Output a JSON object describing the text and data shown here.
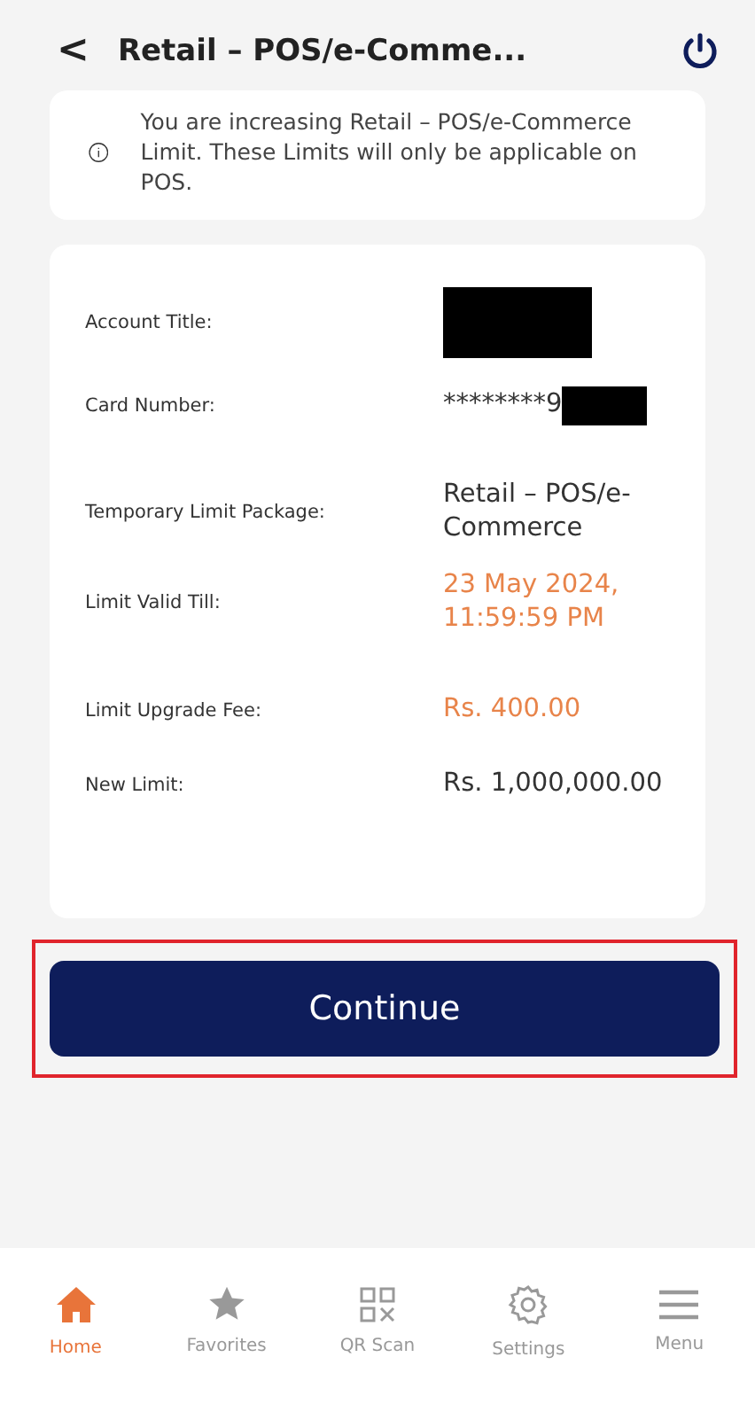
{
  "header": {
    "back": "<",
    "title": "Retail – POS/e-Comme..."
  },
  "notice": {
    "text": "You are increasing Retail – POS/e-Commerce Limit. These Limits will only be applicable on POS."
  },
  "details": [
    {
      "label": "Account Title:",
      "redacted": true
    },
    {
      "label": "Card Number:",
      "value": "********9",
      "redacted": true,
      "accent": false
    },
    {
      "label": "Temporary Limit Package:",
      "value": "Retail – POS/e-Commerce",
      "accent": false
    },
    {
      "label": "Limit Valid Till:",
      "value": "23 May 2024, 11:59:59 PM",
      "accent": true
    },
    {
      "label": "Limit Upgrade Fee:",
      "value": "Rs. 400.00",
      "accent": true
    },
    {
      "label": "New Limit:",
      "value": "Rs. 1,000,000.00",
      "accent": false
    }
  ],
  "button": {
    "label": "Continue",
    "highlighted": true
  },
  "nav": [
    {
      "label": "Home",
      "selected": true
    },
    {
      "label": "Favorites",
      "selected": false
    },
    {
      "label": "QR Scan",
      "selected": false
    },
    {
      "label": "Settings",
      "selected": false
    },
    {
      "label": "Menu",
      "selected": false
    }
  ]
}
